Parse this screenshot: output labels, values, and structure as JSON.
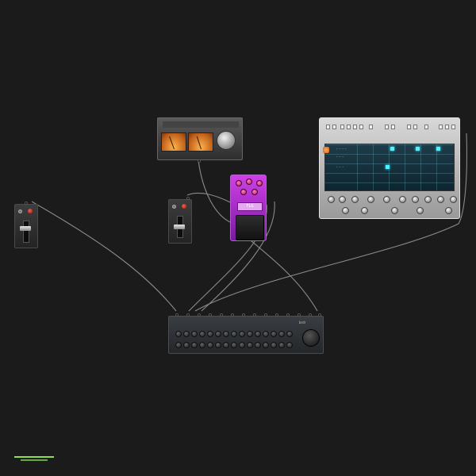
{
  "canvas": {
    "background": "#1b1b1b"
  },
  "devices": {
    "fader_left": {
      "name": "Fader module"
    },
    "fader_middle": {
      "name": "Fader module"
    },
    "vu_meter": {
      "name": "VU meter",
      "accent": "#ffb24a"
    },
    "pedal": {
      "name": "Effect pedal",
      "screen_text": "FLG",
      "accent": "#d040e8"
    },
    "sequencer": {
      "name": "Step sequencer",
      "grid_color": "#4ff0ff"
    },
    "mixer": {
      "name": "Mixer",
      "brand": "brdr",
      "accent": "#e8c070"
    }
  },
  "status_bar": {
    "color": "#8fe04f"
  }
}
